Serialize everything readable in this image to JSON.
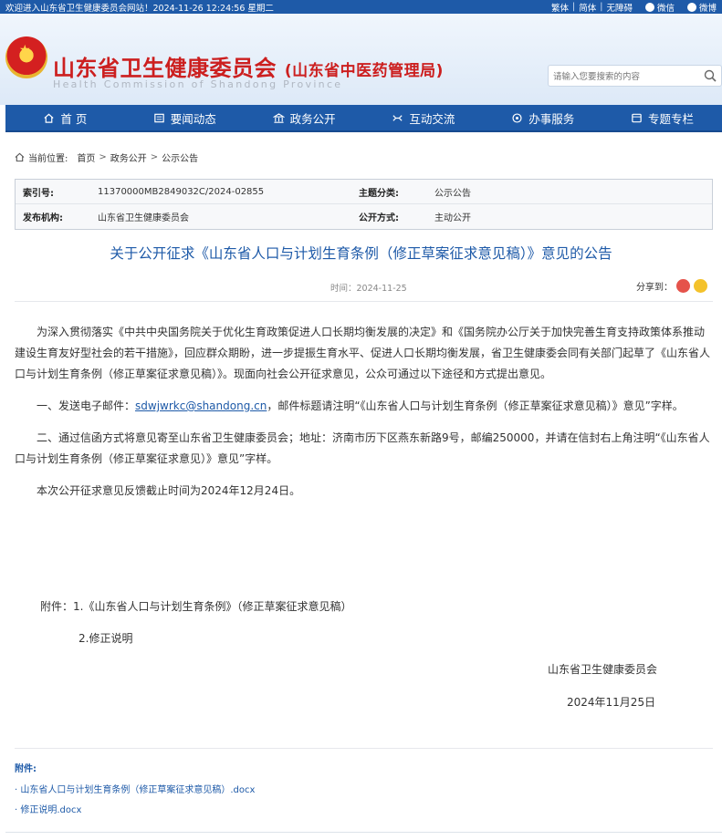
{
  "topbar": {
    "welcome": "欢迎进入山东省卫生健康委员会网站！2024-11-26 12:24:56 星期二",
    "links": [
      "繁体",
      "简体",
      "无障碍"
    ],
    "social": [
      "微信",
      "微博"
    ]
  },
  "header": {
    "title": "山东省卫生健康委员会",
    "subtitle": "(山东省中医药管理局)",
    "en": "Health Commission of Shandong Province",
    "search_placeholder": "请输入您要搜索的内容"
  },
  "nav": {
    "items": [
      {
        "label": "首 页",
        "icon": "home-icon"
      },
      {
        "label": "要闻动态",
        "icon": "news-icon"
      },
      {
        "label": "政务公开",
        "icon": "government-icon"
      },
      {
        "label": "互动交流",
        "icon": "interaction-icon"
      },
      {
        "label": "办事服务",
        "icon": "service-icon"
      },
      {
        "label": "专题专栏",
        "icon": "topic-icon"
      }
    ]
  },
  "breadcrumb": {
    "label": "当前位置:",
    "items": [
      "首页",
      "政务公开",
      "公示公告"
    ]
  },
  "meta": {
    "index_label": "索引号:",
    "index_value": "11370000MB2849032C/2024-02855",
    "category_label": "主题分类:",
    "category_value": "公示公告",
    "publisher_label": "发布机构:",
    "publisher_value": "山东省卫生健康委员会",
    "method_label": "公开方式:",
    "method_value": "主动公开"
  },
  "article": {
    "title": "关于公开征求《山东省人口与计划生育条例（修正草案征求意见稿）》意见的公告",
    "date": "时间：2024-11-25",
    "share_label": "分享到：",
    "paragraphs": {
      "p1": "为深入贯彻落实《中共中央国务院关于优化生育政策促进人口长期均衡发展的决定》和《国务院办公厅关于加快完善生育支持政策体系推动建设生育友好型社会的若干措施》，回应群众期盼，进一步提振生育水平、促进人口长期均衡发展，省卫生健康委会同有关部门起草了《山东省人口与计划生育条例（修正草案征求意见稿）》。现面向社会公开征求意见，公众可通过以下途径和方式提出意见。",
      "p2_prefix": "一、发送电子邮件：",
      "p2_email": "sdwjwrkc@shandong.cn",
      "p2_suffix": "，邮件标题请注明“《山东省人口与计划生育条例（修正草案征求意见稿）》意见”字样。",
      "p3": "二、通过信函方式将意见寄至山东省卫生健康委员会；地址：济南市历下区燕东新路9号，邮编250000，并请在信封右上角注明“《山东省人口与计划生育条例（修正草案征求意见）》意见”字样。",
      "p4": "本次公开征求意见反馈截止时间为2024年12月24日。"
    },
    "attachments_in_body": {
      "line1": "附件：1.《山东省人口与计划生育条例》（修正草案征求意见稿）",
      "line2": "2.修正说明"
    },
    "signature": "山东省卫生健康委员会",
    "signature_date": "2024年11月25日"
  },
  "attachments": {
    "label": "附件:",
    "files": [
      "· 山东省人口与计划生育条例（修正草案征求意见稿）.docx",
      "· 修正说明.docx"
    ]
  },
  "colors": {
    "brand_blue": "#1e5aa8",
    "title_red": "#cc1f1f"
  }
}
